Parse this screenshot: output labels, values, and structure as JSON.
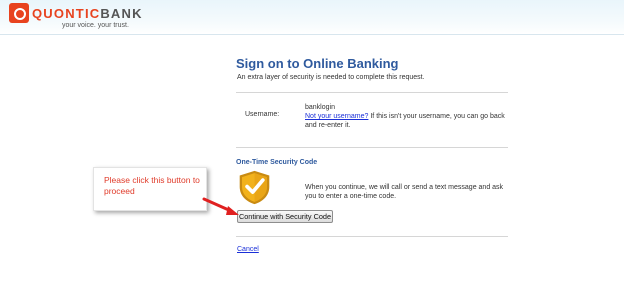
{
  "header": {
    "logo_brand_prefix": "QUONTIC",
    "logo_brand_suffix": "BANK",
    "tagline": "your voice. your trust."
  },
  "main": {
    "title": "Sign on to Online Banking",
    "subtitle": "An extra layer of security is needed to complete this request.",
    "username_label": "Username:",
    "username_value": "banklogin",
    "not_you_link": "Not your username?",
    "not_you_text": " If this isn't your username, you can go back and re-enter it.",
    "section_title": "One-Time Security Code",
    "description": "When you continue, we will call or send a text message and ask you to enter a one-time code.",
    "continue_button": "Continue with Security Code",
    "cancel_link": "Cancel"
  },
  "annotation": {
    "callout_text": "Please click this button to proceed"
  },
  "colors": {
    "brand": "#e8431f",
    "heading": "#2f5a9e",
    "link": "#1a2fd8",
    "callout_text": "#e03b2a",
    "arrow": "#e02020",
    "shield_gold": "#f2b21c"
  },
  "icons": {
    "logo": "quontic-logo-icon",
    "shield": "shield-check-icon",
    "arrow": "arrow-icon"
  }
}
